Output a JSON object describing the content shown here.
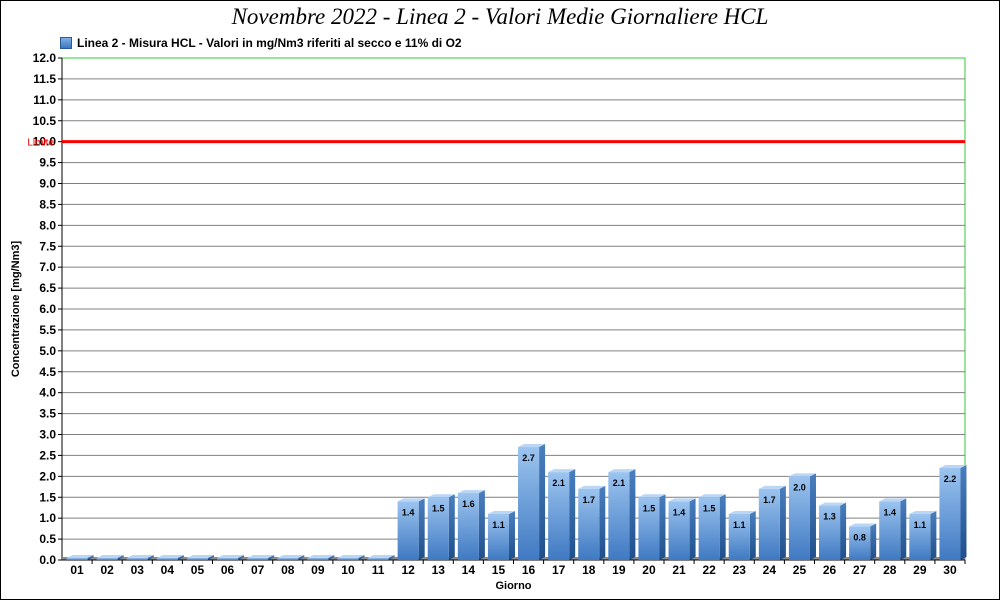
{
  "chart_data": {
    "type": "bar",
    "title": "Novembre 2022 - Linea 2 - Valori Medie Giornaliere HCL",
    "xlabel": "Giorno",
    "ylabel": "Concentrazione [mg/Nm3]",
    "ylim": [
      0,
      12
    ],
    "y_tick_step": 0.5,
    "grid": true,
    "legend_position": "top-left",
    "series": [
      {
        "name": "Linea 2 - Misura HCL - Valori in mg/Nm3 riferiti al secco e 11% di O2",
        "color": "#5b94d6",
        "values": [
          0,
          0,
          0,
          0,
          0,
          0,
          0,
          0,
          0,
          0,
          0,
          1.4,
          1.5,
          1.6,
          1.1,
          2.7,
          2.1,
          1.7,
          2.1,
          1.5,
          1.4,
          1.5,
          1.1,
          1.7,
          2.0,
          1.3,
          0.8,
          1.4,
          1.1,
          2.2
        ]
      }
    ],
    "categories": [
      "01",
      "02",
      "03",
      "04",
      "05",
      "06",
      "07",
      "08",
      "09",
      "10",
      "11",
      "12",
      "13",
      "14",
      "15",
      "16",
      "17",
      "18",
      "19",
      "20",
      "21",
      "22",
      "23",
      "24",
      "25",
      "26",
      "27",
      "28",
      "29",
      "30"
    ],
    "data_labels": [
      "",
      "",
      "",
      "",
      "",
      "",
      "",
      "",
      "",
      "",
      "",
      "1.4",
      "1.5",
      "1.6",
      "1.1",
      "2.7",
      "2.1",
      "1.7",
      "2.1",
      "1.5",
      "1.4",
      "1.5",
      "1.1",
      "1.7",
      "2.0",
      "1.3",
      "0.8",
      "1.4",
      "1.1",
      "2.2"
    ],
    "limit_line": {
      "label": "Limite",
      "value": 10,
      "color": "#ff0000"
    },
    "plot_border_color": "#33cc33"
  }
}
